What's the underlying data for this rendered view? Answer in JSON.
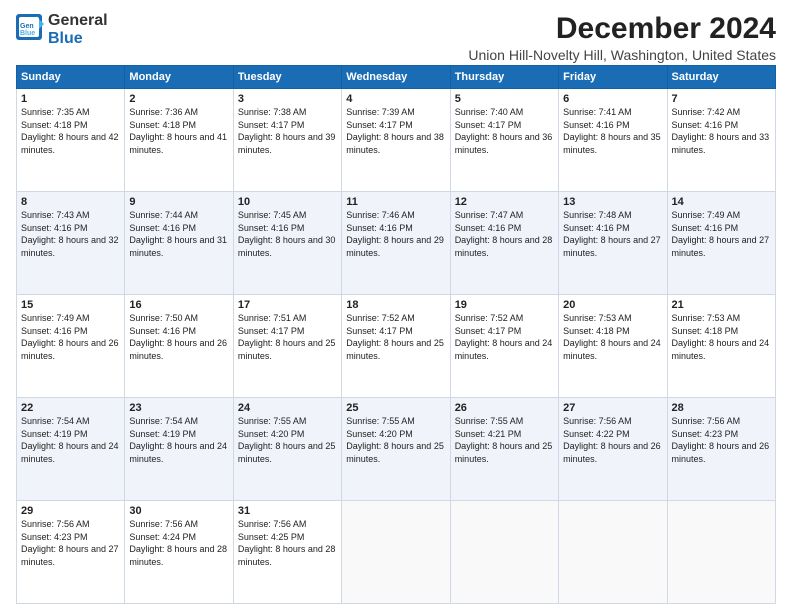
{
  "logo": {
    "line1": "General",
    "line2": "Blue"
  },
  "title": "December 2024",
  "subtitle": "Union Hill-Novelty Hill, Washington, United States",
  "headers": [
    "Sunday",
    "Monday",
    "Tuesday",
    "Wednesday",
    "Thursday",
    "Friday",
    "Saturday"
  ],
  "weeks": [
    [
      {
        "day": "1",
        "rise": "7:35 AM",
        "set": "4:18 PM",
        "daylight": "8 hours and 42 minutes."
      },
      {
        "day": "2",
        "rise": "7:36 AM",
        "set": "4:18 PM",
        "daylight": "8 hours and 41 minutes."
      },
      {
        "day": "3",
        "rise": "7:38 AM",
        "set": "4:17 PM",
        "daylight": "8 hours and 39 minutes."
      },
      {
        "day": "4",
        "rise": "7:39 AM",
        "set": "4:17 PM",
        "daylight": "8 hours and 38 minutes."
      },
      {
        "day": "5",
        "rise": "7:40 AM",
        "set": "4:17 PM",
        "daylight": "8 hours and 36 minutes."
      },
      {
        "day": "6",
        "rise": "7:41 AM",
        "set": "4:16 PM",
        "daylight": "8 hours and 35 minutes."
      },
      {
        "day": "7",
        "rise": "7:42 AM",
        "set": "4:16 PM",
        "daylight": "8 hours and 33 minutes."
      }
    ],
    [
      {
        "day": "8",
        "rise": "7:43 AM",
        "set": "4:16 PM",
        "daylight": "8 hours and 32 minutes."
      },
      {
        "day": "9",
        "rise": "7:44 AM",
        "set": "4:16 PM",
        "daylight": "8 hours and 31 minutes."
      },
      {
        "day": "10",
        "rise": "7:45 AM",
        "set": "4:16 PM",
        "daylight": "8 hours and 30 minutes."
      },
      {
        "day": "11",
        "rise": "7:46 AM",
        "set": "4:16 PM",
        "daylight": "8 hours and 29 minutes."
      },
      {
        "day": "12",
        "rise": "7:47 AM",
        "set": "4:16 PM",
        "daylight": "8 hours and 28 minutes."
      },
      {
        "day": "13",
        "rise": "7:48 AM",
        "set": "4:16 PM",
        "daylight": "8 hours and 27 minutes."
      },
      {
        "day": "14",
        "rise": "7:49 AM",
        "set": "4:16 PM",
        "daylight": "8 hours and 27 minutes."
      }
    ],
    [
      {
        "day": "15",
        "rise": "7:49 AM",
        "set": "4:16 PM",
        "daylight": "8 hours and 26 minutes."
      },
      {
        "day": "16",
        "rise": "7:50 AM",
        "set": "4:16 PM",
        "daylight": "8 hours and 26 minutes."
      },
      {
        "day": "17",
        "rise": "7:51 AM",
        "set": "4:17 PM",
        "daylight": "8 hours and 25 minutes."
      },
      {
        "day": "18",
        "rise": "7:52 AM",
        "set": "4:17 PM",
        "daylight": "8 hours and 25 minutes."
      },
      {
        "day": "19",
        "rise": "7:52 AM",
        "set": "4:17 PM",
        "daylight": "8 hours and 24 minutes."
      },
      {
        "day": "20",
        "rise": "7:53 AM",
        "set": "4:18 PM",
        "daylight": "8 hours and 24 minutes."
      },
      {
        "day": "21",
        "rise": "7:53 AM",
        "set": "4:18 PM",
        "daylight": "8 hours and 24 minutes."
      }
    ],
    [
      {
        "day": "22",
        "rise": "7:54 AM",
        "set": "4:19 PM",
        "daylight": "8 hours and 24 minutes."
      },
      {
        "day": "23",
        "rise": "7:54 AM",
        "set": "4:19 PM",
        "daylight": "8 hours and 24 minutes."
      },
      {
        "day": "24",
        "rise": "7:55 AM",
        "set": "4:20 PM",
        "daylight": "8 hours and 25 minutes."
      },
      {
        "day": "25",
        "rise": "7:55 AM",
        "set": "4:20 PM",
        "daylight": "8 hours and 25 minutes."
      },
      {
        "day": "26",
        "rise": "7:55 AM",
        "set": "4:21 PM",
        "daylight": "8 hours and 25 minutes."
      },
      {
        "day": "27",
        "rise": "7:56 AM",
        "set": "4:22 PM",
        "daylight": "8 hours and 26 minutes."
      },
      {
        "day": "28",
        "rise": "7:56 AM",
        "set": "4:23 PM",
        "daylight": "8 hours and 26 minutes."
      }
    ],
    [
      {
        "day": "29",
        "rise": "7:56 AM",
        "set": "4:23 PM",
        "daylight": "8 hours and 27 minutes."
      },
      {
        "day": "30",
        "rise": "7:56 AM",
        "set": "4:24 PM",
        "daylight": "8 hours and 28 minutes."
      },
      {
        "day": "31",
        "rise": "7:56 AM",
        "set": "4:25 PM",
        "daylight": "8 hours and 28 minutes."
      },
      null,
      null,
      null,
      null
    ]
  ]
}
